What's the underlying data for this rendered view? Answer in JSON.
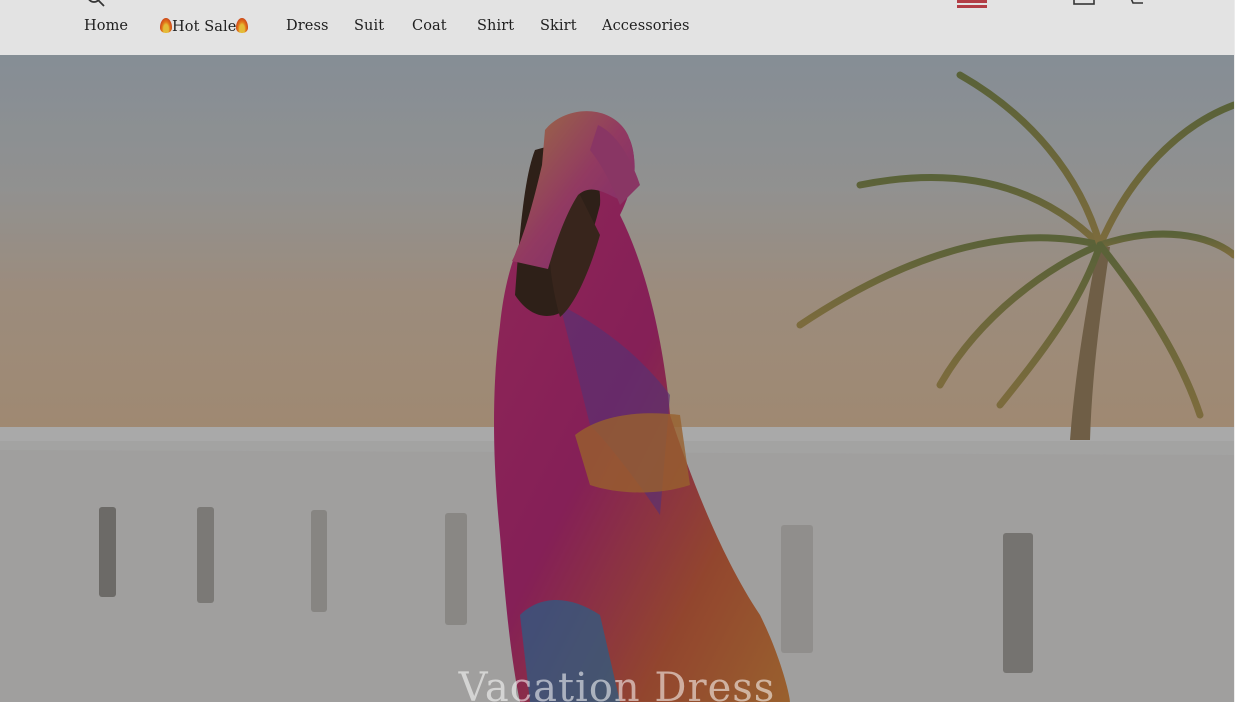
{
  "nav": {
    "items": [
      {
        "label": "Home"
      },
      {
        "label": "Hot Sale"
      },
      {
        "label": "Dress"
      },
      {
        "label": "Suit"
      },
      {
        "label": "Coat"
      },
      {
        "label": "Shirt"
      },
      {
        "label": "Skirt"
      },
      {
        "label": "Accessories"
      }
    ]
  },
  "icons": {
    "search": "search-icon",
    "flag": "flag-icon",
    "account": "account-icon",
    "cart": "cart-icon",
    "fire": "fire-icon"
  },
  "hero": {
    "title": "Vacation Dress",
    "accent": "#ffffff"
  }
}
